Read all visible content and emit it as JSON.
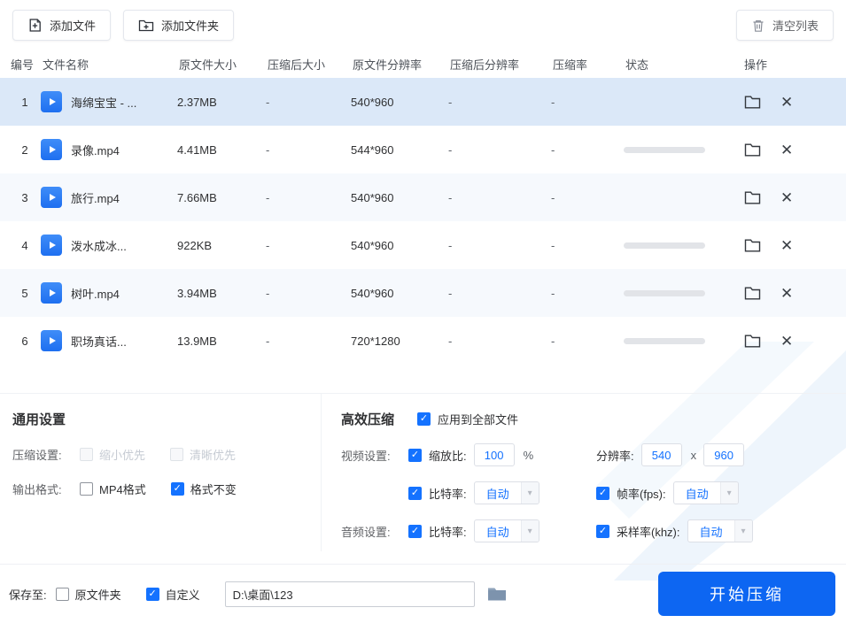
{
  "colors": {
    "primary": "#1472ff",
    "start_button": "#0d66f2",
    "row_selected": "#dbe8f8",
    "row_alt": "#f6f9fd"
  },
  "icons": {
    "close": "✕",
    "caret_down": "▾"
  },
  "toolbar": {
    "add_file": "添加文件",
    "add_folder": "添加文件夹",
    "clear_list": "清空列表"
  },
  "table": {
    "headers": [
      "编号",
      "文件名称",
      "原文件大小",
      "压缩后大小",
      "原文件分辨率",
      "压缩后分辨率",
      "压缩率",
      "状态",
      "操作"
    ],
    "rows": [
      {
        "no": "1",
        "name": "海绵宝宝 - ...",
        "orig_size": "2.37MB",
        "comp_size": "-",
        "orig_res": "540*960",
        "comp_res": "-",
        "ratio": "-",
        "has_progress": false
      },
      {
        "no": "2",
        "name": "录像.mp4",
        "orig_size": "4.41MB",
        "comp_size": "-",
        "orig_res": "544*960",
        "comp_res": "-",
        "ratio": "-",
        "has_progress": true
      },
      {
        "no": "3",
        "name": "旅行.mp4",
        "orig_size": "7.66MB",
        "comp_size": "-",
        "orig_res": "540*960",
        "comp_res": "-",
        "ratio": "-",
        "has_progress": false
      },
      {
        "no": "4",
        "name": "泼水成冰...",
        "orig_size": "922KB",
        "comp_size": "-",
        "orig_res": "540*960",
        "comp_res": "-",
        "ratio": "-",
        "has_progress": true
      },
      {
        "no": "5",
        "name": "树叶.mp4",
        "orig_size": "3.94MB",
        "comp_size": "-",
        "orig_res": "540*960",
        "comp_res": "-",
        "ratio": "-",
        "has_progress": true
      },
      {
        "no": "6",
        "name": "职场真话...",
        "orig_size": "13.9MB",
        "comp_size": "-",
        "orig_res": "720*1280",
        "comp_res": "-",
        "ratio": "-",
        "has_progress": true
      }
    ]
  },
  "general": {
    "title": "通用设置",
    "compress_label": "压缩设置:",
    "shrink_first": "缩小优先",
    "clarity_first": "清晰优先",
    "output_label": "输出格式:",
    "mp4_format": "MP4格式",
    "keep_format": "格式不变"
  },
  "efficient": {
    "title": "高效压缩",
    "apply_all": "应用到全部文件",
    "video_label": "视频设置:",
    "scale_label": "缩放比:",
    "scale_value": "100",
    "percent": "%",
    "resolution_label": "分辨率:",
    "res_w": "540",
    "res_x": "x",
    "res_h": "960",
    "bitrate_label": "比特率:",
    "bitrate_value": "自动",
    "fps_label": "帧率(fps):",
    "fps_value": "自动",
    "audio_label": "音频设置:",
    "audio_bitrate_label": "比特率:",
    "audio_bitrate_value": "自动",
    "sample_label": "采样率(khz):",
    "sample_value": "自动"
  },
  "footer": {
    "save_label": "保存至:",
    "original_folder": "原文件夹",
    "custom": "自定义",
    "path": "D:\\桌面\\123",
    "start": "开始压缩"
  }
}
